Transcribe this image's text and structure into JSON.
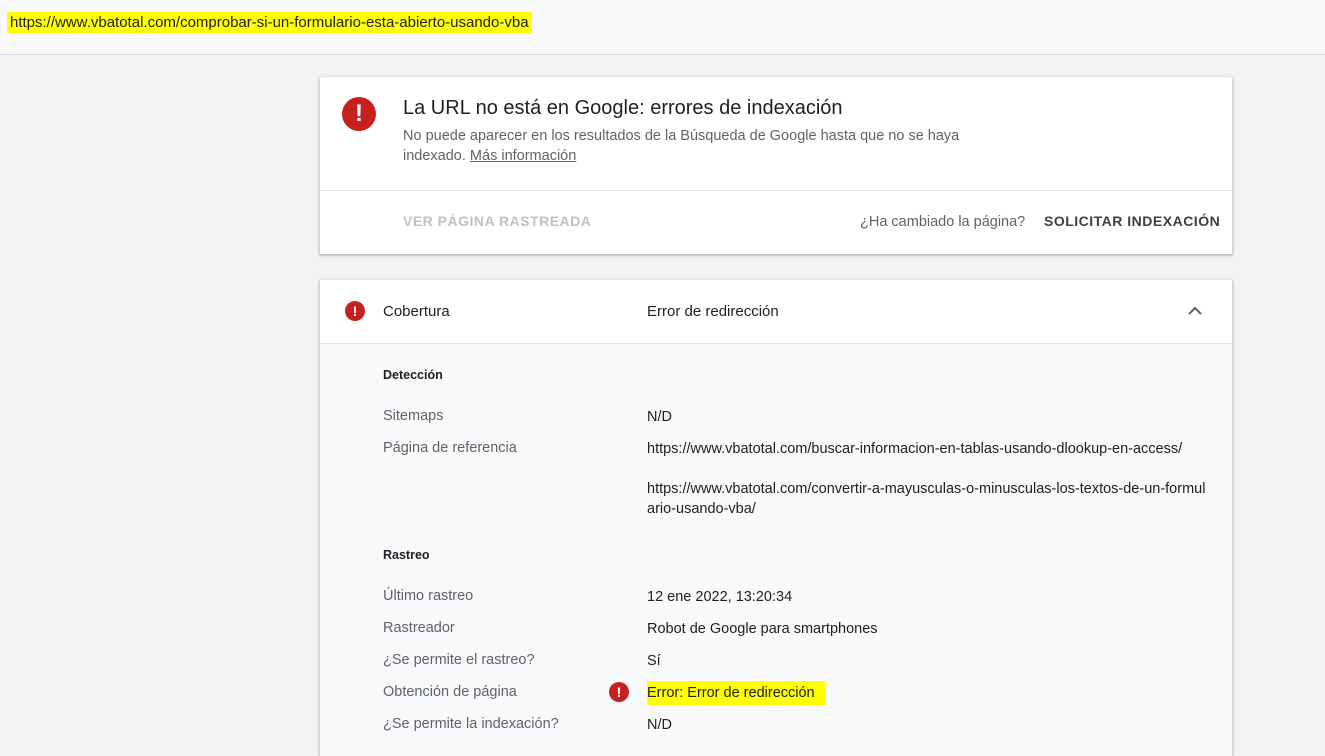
{
  "url_bar": {
    "url": "https://www.vbatotal.com/comprobar-si-un-formulario-esta-abierto-usando-vba"
  },
  "status_card": {
    "icon": "!",
    "title": "La URL no está en Google: errores de indexación",
    "description": "No puede aparecer en los resultados de la Búsqueda de Google hasta que no se haya indexado.",
    "more_info": "Más información",
    "view_crawled": "VER PÁGINA RASTREADA",
    "changed_question": "¿Ha cambiado la página?",
    "request_indexing": "SOLICITAR INDEXACIÓN"
  },
  "coverage": {
    "icon": "!",
    "label": "Cobertura",
    "value": "Error de redirección",
    "detection": {
      "title": "Detección",
      "sitemaps_label": "Sitemaps",
      "sitemaps_value": "N/D",
      "referring_label": "Página de referencia",
      "referring_pages": [
        "https://www.vbatotal.com/buscar-informacion-en-tablas-usando-dlookup-en-access/",
        "https://www.vbatotal.com/convertir-a-mayusculas-o-minusculas-los-textos-de-un-formulario-usando-vba/"
      ]
    },
    "crawl": {
      "title": "Rastreo",
      "last_crawl_label": "Último rastreo",
      "last_crawl_value": "12 ene 2022, 13:20:34",
      "crawler_label": "Rastreador",
      "crawler_value": "Robot de Google para smartphones",
      "crawl_allowed_label": "¿Se permite el rastreo?",
      "crawl_allowed_value": "Sí",
      "fetch_label": "Obtención de página",
      "fetch_value": "Error: Error de redirección",
      "index_allowed_label": "¿Se permite la indexación?",
      "index_allowed_value": "N/D"
    }
  },
  "colors": {
    "error": "#c5221f",
    "highlight": "#ffff00"
  }
}
